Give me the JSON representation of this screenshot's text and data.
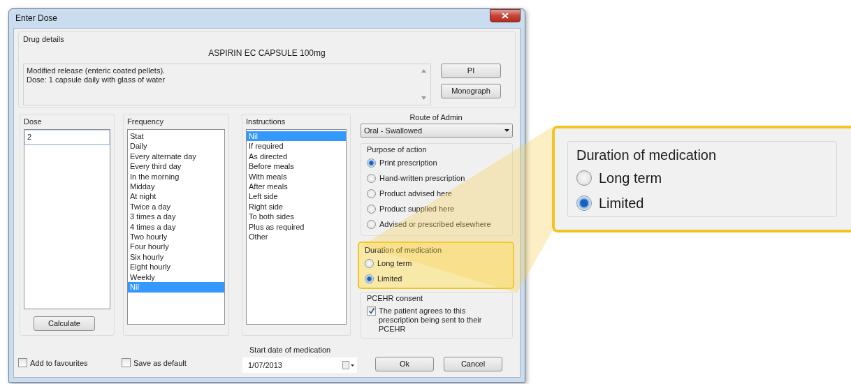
{
  "window": {
    "title": "Enter Dose"
  },
  "drug_details": {
    "title": "Drug details",
    "name": "ASPIRIN EC CAPSULE 100mg",
    "description": [
      "Modified release (enteric coated pellets).",
      "Dose: 1 capsule daily with glass of water"
    ],
    "buttons": [
      "PI",
      "Monograph"
    ]
  },
  "dose": {
    "label": "Dose",
    "value": "2",
    "button": "Calculate"
  },
  "frequency": {
    "label": "Frequency",
    "items": [
      {
        "label": "Stat",
        "selected": false
      },
      {
        "label": "Daily",
        "selected": false
      },
      {
        "label": "Every alternate day",
        "selected": false
      },
      {
        "label": "Every third day",
        "selected": false
      },
      {
        "label": "In the morning",
        "selected": false
      },
      {
        "label": "Midday",
        "selected": false
      },
      {
        "label": "At night",
        "selected": false
      },
      {
        "label": "Twice a day",
        "selected": false
      },
      {
        "label": "3 times a day",
        "selected": false
      },
      {
        "label": "4 times a day",
        "selected": false
      },
      {
        "label": "Two hourly",
        "selected": false
      },
      {
        "label": "Four hourly",
        "selected": false
      },
      {
        "label": "Six hourly",
        "selected": false
      },
      {
        "label": "Eight hourly",
        "selected": false
      },
      {
        "label": "Weekly",
        "selected": false
      },
      {
        "label": "Nil",
        "selected": true
      }
    ]
  },
  "instructions": {
    "label": "Instructions",
    "items": [
      {
        "label": "Nil",
        "selected": true
      },
      {
        "label": "If required",
        "selected": false
      },
      {
        "label": "As directed",
        "selected": false
      },
      {
        "label": "Before meals",
        "selected": false
      },
      {
        "label": "With meals",
        "selected": false
      },
      {
        "label": "After meals",
        "selected": false
      },
      {
        "label": "Left side",
        "selected": false
      },
      {
        "label": "Right side",
        "selected": false
      },
      {
        "label": "To both sides",
        "selected": false
      },
      {
        "label": "Plus as required",
        "selected": false
      },
      {
        "label": "Other",
        "selected": false
      }
    ]
  },
  "route": {
    "label": "Route of Admin",
    "value": "Oral - Swallowed"
  },
  "purpose": {
    "title": "Purpose of action",
    "options": [
      {
        "label": "Print prescription",
        "selected": true
      },
      {
        "label": "Hand-written prescription",
        "selected": false
      },
      {
        "label": "Product advised here",
        "selected": false
      },
      {
        "label": "Product supplied here",
        "selected": false
      },
      {
        "label": "Advised or prescribed elsewhere",
        "selected": false
      }
    ]
  },
  "duration": {
    "title": "Duration of medication",
    "highlighted": true,
    "options": [
      {
        "label": "Long term",
        "selected": false
      },
      {
        "label": "Limited",
        "selected": true
      }
    ]
  },
  "pcehr": {
    "title": "PCEHR consent",
    "consent": {
      "label": "The patient agrees to this prescription being sent to their PCEHR",
      "checked": true
    }
  },
  "options": [
    {
      "label": "Add to favourites",
      "checked": false
    },
    {
      "label": "Save as default",
      "checked": false
    }
  ],
  "start_date": {
    "label": "Start date of medication",
    "value": "1/07/2013"
  },
  "buttons": [
    "Ok",
    "Cancel"
  ],
  "callout": {
    "title": "Duration of medication",
    "options": [
      {
        "label": "Long term",
        "selected": false
      },
      {
        "label": "Limited",
        "selected": true
      }
    ]
  }
}
